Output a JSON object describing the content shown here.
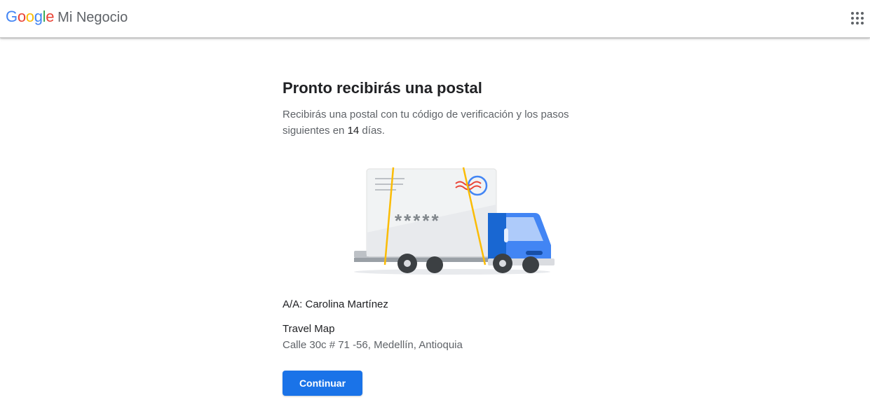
{
  "header": {
    "brand": {
      "letters": [
        {
          "ch": "G",
          "color": "#4285f4"
        },
        {
          "ch": "o",
          "color": "#ea4335"
        },
        {
          "ch": "o",
          "color": "#fbbc05"
        },
        {
          "ch": "g",
          "color": "#4285f4"
        },
        {
          "ch": "l",
          "color": "#34a853"
        },
        {
          "ch": "e",
          "color": "#ea4335"
        }
      ],
      "product": "Mi Negocio"
    },
    "apps_icon": "apps-grid-icon"
  },
  "main": {
    "title": "Pronto recibirás una postal",
    "description_before": "Recibirás una postal con tu código de verificación y los pasos siguientes en ",
    "description_days": "14",
    "description_after": " días.",
    "illustration": {
      "code_mask": "*****",
      "icon": "delivery-truck-postcard-icon"
    },
    "recipient": "A/A: Carolina Martínez",
    "business_name": "Travel Map",
    "business_address": "Calle 30c # 71 -56, Medellín, Antioquia",
    "continue_label": "Continuar"
  },
  "colors": {
    "accent": "#1a73e8",
    "truck_blue": "#4285f4",
    "strap_yellow": "#fbbc05",
    "text_primary": "#202124",
    "text_secondary": "#5f6368"
  }
}
